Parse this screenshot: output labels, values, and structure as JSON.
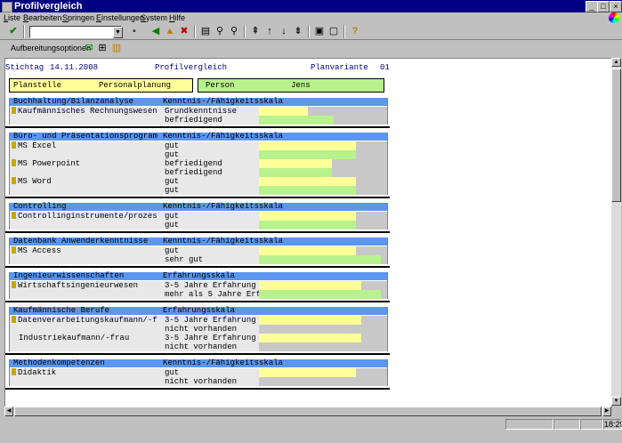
{
  "window": {
    "title": "Profilvergleich"
  },
  "menu": [
    "Liste",
    "Bearbeiten",
    "Springen",
    "Einstellungen",
    "System",
    "Hilfe"
  ],
  "toolbar2": {
    "options_label": "Aufbereitungsoptionen"
  },
  "header": {
    "stichtag_label": "Stichtag",
    "stichtag_value": "14.11.2008",
    "report_title": "Profilvergleich",
    "plan_label": "Planvariante",
    "plan_value": "01"
  },
  "top": {
    "planstelle_label": "Planstelle",
    "planstelle_value": "Personalplanung",
    "person_label": "Person",
    "person_value": "Jens"
  },
  "sections": [
    {
      "title": "Buchhaltung/Bilanzanalyse",
      "scale": "Kenntnis-/Fähigkeitsskala",
      "rows": [
        {
          "label": "Kaufmännisches Rechnungswesen",
          "pin": true,
          "level": "Grundkenntnisse",
          "color": "#ffff99",
          "fill": 0.38
        },
        {
          "label": "",
          "pin": false,
          "level": "befriedigend",
          "color": "#b8f28c",
          "fill": 0.58
        }
      ]
    },
    {
      "title": "Büro- und Präsentationsprogram",
      "scale": "Kenntnis-/Fähigkeitsskala",
      "rows": [
        {
          "label": "MS Excel",
          "pin": true,
          "level": "gut",
          "color": "#ffff99",
          "fill": 0.76
        },
        {
          "label": "",
          "pin": false,
          "level": "gut",
          "color": "#b8f28c",
          "fill": 0.76
        },
        {
          "label": "MS Powerpoint",
          "pin": true,
          "level": "befriedigend",
          "color": "#ffff99",
          "fill": 0.57
        },
        {
          "label": "",
          "pin": false,
          "level": "befriedigend",
          "color": "#b8f28c",
          "fill": 0.57
        },
        {
          "label": "MS Word",
          "pin": true,
          "level": "gut",
          "color": "#ffff99",
          "fill": 0.76
        },
        {
          "label": "",
          "pin": false,
          "level": "gut",
          "color": "#b8f28c",
          "fill": 0.76
        }
      ]
    },
    {
      "title": "Controlling",
      "scale": "Kenntnis-/Fähigkeitsskala",
      "rows": [
        {
          "label": "Controllinginstrumente/prozes",
          "pin": true,
          "level": "gut",
          "color": "#ffff99",
          "fill": 0.76
        },
        {
          "label": "",
          "pin": false,
          "level": "gut",
          "color": "#b8f28c",
          "fill": 0.76
        }
      ]
    },
    {
      "title": "Datenbank Anwenderkenntnisse",
      "scale": "Kenntnis-/Fähigkeitsskala",
      "rows": [
        {
          "label": "MS Access",
          "pin": true,
          "level": "gut",
          "color": "#ffff99",
          "fill": 0.76
        },
        {
          "label": "",
          "pin": false,
          "level": "sehr gut",
          "color": "#b8f28c",
          "fill": 0.95
        }
      ]
    },
    {
      "title": "Ingenieurwissenschaften",
      "scale": "Erfahrungsskala",
      "rows": [
        {
          "label": "Wirtschaftsingenieurwesen",
          "pin": true,
          "level": "3-5 Jahre Erfahrung",
          "color": "#ffff99",
          "fill": 0.8
        },
        {
          "label": "",
          "pin": false,
          "level": "mehr als 5 Jahre Erf",
          "color": "#b8f28c",
          "fill": 0.95
        }
      ]
    },
    {
      "title": "Kaufmännische Berufe",
      "scale": "Erfahrungsskala",
      "rows": [
        {
          "label": "Datenverarbeitungskaufmann/-f",
          "pin": true,
          "level": "3-5 Jahre Erfahrung",
          "color": "#ffff99",
          "fill": 0.8
        },
        {
          "label": "",
          "pin": false,
          "level": "nicht vorhanden",
          "color": "#b8f28c",
          "fill": 0
        },
        {
          "label": "Industriekaufmann/-frau",
          "pin": false,
          "level": "3-5 Jahre Erfahrung",
          "color": "#ffff99",
          "fill": 0.8
        },
        {
          "label": "",
          "pin": false,
          "level": "nicht vorhanden",
          "color": "#b8f28c",
          "fill": 0
        }
      ]
    },
    {
      "title": "Methodenkompetenzen",
      "scale": "Kenntnis-/Fähigkeitsskala",
      "rows": [
        {
          "label": "Didaktik",
          "pin": true,
          "level": "gut",
          "color": "#ffff99",
          "fill": 0.76
        },
        {
          "label": "",
          "pin": false,
          "level": "nicht vorhanden",
          "color": "#b8f28c",
          "fill": 0
        }
      ]
    }
  ],
  "status": {
    "time": "18:29"
  }
}
